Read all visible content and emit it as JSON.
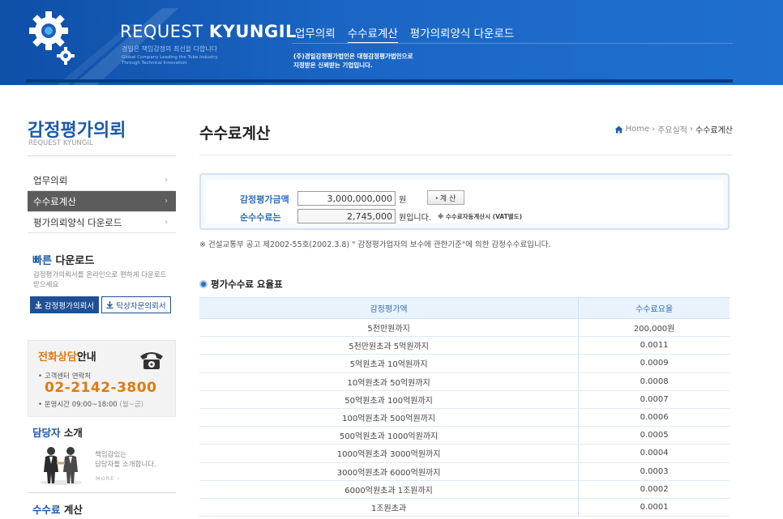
{
  "header": {
    "brand_light": "REQUEST",
    "brand_bold": "KYUNGIL",
    "slogan": "경일은 책임감정의 최선을 다합니다",
    "slogan_en_1": "Global Company Leading the Tube Industry",
    "slogan_en_2": "Through Technical Innovation",
    "nav": [
      "업무의뢰",
      "수수료계산",
      "평가의뢰양식 다운로드"
    ],
    "desc_1": "(주)경일감정평가법인은 대형감정평가법인으로",
    "desc_2": "지정받은 신뢰받는 기업입니다."
  },
  "sidebar": {
    "title": "감정평가의뢰",
    "subtitle": "REQUEST KYUNGIL",
    "items": [
      {
        "label": "업무의뢰",
        "chev": "›"
      },
      {
        "label": "수수료계산",
        "chev": "›"
      },
      {
        "label": "평가의뢰양식 다운로드",
        "chev": "›"
      }
    ],
    "quick_download": {
      "title_blue": "빠른",
      "title_rest": " 다운로드",
      "desc": "감정평가의뢰서를 온라인으로 편하게 다운로드 받으세요",
      "btn1": "감정평가의뢰서",
      "btn2": "탁상자문의뢰서"
    },
    "phone": {
      "title_orange": "전화상담",
      "title_rest": "안내",
      "line1": "• 고객센터 연락처",
      "number": "02-2142-3800",
      "line2": "• 운영시간 09:00~18:00",
      "line2_gray": " (월~금)"
    },
    "staff": {
      "title_blue": "담당자",
      "title_rest": " 소개",
      "text1": "책임감있는",
      "text2": "담당자를 소개합니다.",
      "more": "MORE ›"
    },
    "fee": {
      "title_blue": "수수료",
      "title_rest": " 계산"
    }
  },
  "main": {
    "page_title": "수수료계산",
    "breadcrumb": [
      "Home",
      "주요실적",
      "수수료계산"
    ],
    "breadcrumb_sep": "›",
    "calc": {
      "label_amount": "감정평가금액",
      "amount_value": "3,000,000,000",
      "unit_won": "원",
      "button": "계 산",
      "label_fee": "순수수료는",
      "fee_value": "2,745,000",
      "unit_fee": "원입니다.",
      "note": "※ 수수료자동계산시 (VAT별도)"
    },
    "basis_note": "※ 건설교통부 공고 제2002-55호(2002.3.8) \" 감정평가업자의 보수에 관한기준\"에 의한 감정수수료입니다.",
    "rate_title": "평가수수료 요율표",
    "rate_table": {
      "headers": [
        "감정평가액",
        "수수료요율"
      ],
      "rows": [
        [
          "5천만원까지",
          "200,000원"
        ],
        [
          "5천만원초과 5억원까지",
          "0.0011"
        ],
        [
          "5억원초과 10억원까지",
          "0.0009"
        ],
        [
          "10억원초과 50억원까지",
          "0.0008"
        ],
        [
          "50억원초과 100억원까지",
          "0.0007"
        ],
        [
          "100억원초과 500억원까지",
          "0.0006"
        ],
        [
          "500억원초과 1000억원까지",
          "0.0005"
        ],
        [
          "1000억원초과 3000억원까지",
          "0.0004"
        ],
        [
          "3000억원초과 6000억원까지",
          "0.0003"
        ],
        [
          "6000억원초과 1조원까지",
          "0.0002"
        ],
        [
          "1조원초과",
          "0.0001"
        ]
      ]
    }
  }
}
